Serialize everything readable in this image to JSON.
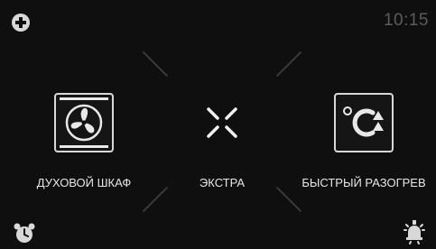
{
  "status": {
    "time": "10:15"
  },
  "icons": {
    "add": "plus-circle-icon",
    "alarm": "alarm-clock-icon",
    "lamp": "lamp-icon",
    "fan": "fan-icon",
    "extra": "collapse-arrows-icon",
    "preheat": "celsius-up-arrows-icon"
  },
  "modes": {
    "oven": {
      "label": "ДУХОВОЙ ШКАФ"
    },
    "extra": {
      "label": "ЭКСТРА"
    },
    "preheat": {
      "label": "БЫСТРЫЙ РАЗОГРЕВ"
    }
  },
  "colors": {
    "background": "#0f0f0f",
    "foreground": "#e8e8e8",
    "muted": "#5c5c5c"
  }
}
